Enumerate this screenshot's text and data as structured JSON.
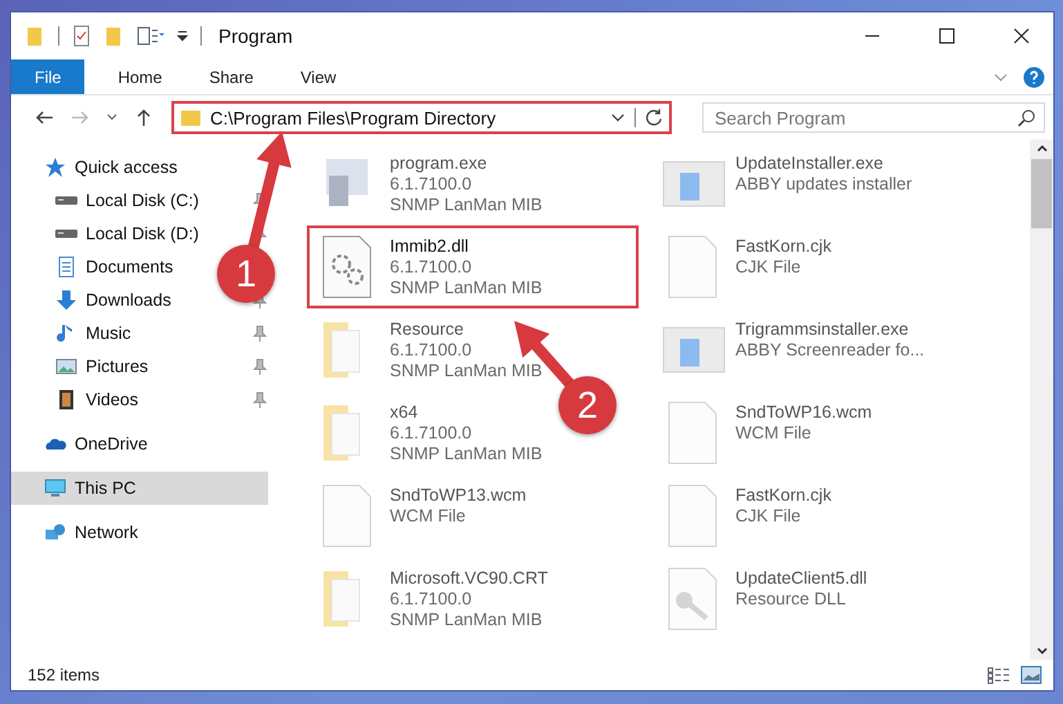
{
  "window": {
    "title": "Program"
  },
  "ribbon_tabs": [
    {
      "label": "File",
      "kind": "file"
    },
    {
      "label": "Home",
      "kind": "tab"
    },
    {
      "label": "Share",
      "kind": "tab"
    },
    {
      "label": "View",
      "kind": "tab"
    }
  ],
  "address": {
    "path": "C:\\Program Files\\Program Directory",
    "highlighted": true
  },
  "search": {
    "placeholder": "Search Program"
  },
  "sidebar": [
    {
      "label": "Quick access",
      "kind": "star",
      "selected": false,
      "children": [
        {
          "label": "Local Disk (C:)",
          "kind": "drive",
          "pinned": true,
          "selected": false
        },
        {
          "label": "Local Disk (D:)",
          "kind": "drive",
          "pinned": true,
          "selected": false
        },
        {
          "label": "Documents",
          "kind": "document",
          "selected": false
        },
        {
          "label": "Downloads",
          "kind": "download",
          "pinned": true,
          "selected": false
        },
        {
          "label": "Music",
          "kind": "music",
          "pinned": true,
          "selected": false
        },
        {
          "label": "Pictures",
          "kind": "pictures",
          "pinned": true,
          "selected": false
        },
        {
          "label": "Videos",
          "kind": "videos",
          "pinned": true,
          "selected": false
        }
      ]
    },
    {
      "label": "OneDrive",
      "kind": "cloud",
      "selected": false
    },
    {
      "label": "This PC",
      "kind": "pc",
      "selected": true
    },
    {
      "label": "Network",
      "kind": "network",
      "selected": false
    }
  ],
  "files": [
    {
      "name": "program.exe",
      "details": [
        "6.1.7100.0",
        "SNMP LanMan MIB"
      ],
      "kind": "program",
      "highlighted": false
    },
    {
      "name": "Immib2.dll",
      "details": [
        "6.1.7100.0",
        "SNMP LanMan MIB"
      ],
      "kind": "dll",
      "highlighted": true
    },
    {
      "name": "Resource",
      "details": [
        "6.1.7100.0",
        "SNMP LanMan MIB"
      ],
      "kind": "folder",
      "highlighted": false
    },
    {
      "name": "x64",
      "details": [
        "6.1.7100.0",
        "SNMP LanMan MIB"
      ],
      "kind": "folder",
      "highlighted": false
    },
    {
      "name": "SndToWP13.wcm",
      "details": [
        "WCM File"
      ],
      "kind": "file",
      "highlighted": false
    },
    {
      "name": "Microsoft.VC90.CRT",
      "details": [
        "6.1.7100.0",
        "SNMP LanMan MIB"
      ],
      "kind": "folder",
      "highlighted": false
    },
    {
      "name": "UpdateInstaller.exe",
      "details": [
        "ABBY updates installer"
      ],
      "kind": "installer",
      "highlighted": false
    },
    {
      "name": "FastKorn.cjk",
      "details": [
        "CJK File"
      ],
      "kind": "file",
      "highlighted": false
    },
    {
      "name": "Trigrammsinstaller.exe",
      "details": [
        "ABBY Screenreader fo..."
      ],
      "kind": "installer",
      "highlighted": false
    },
    {
      "name": "SndToWP16.wcm",
      "details": [
        "WCM File"
      ],
      "kind": "file",
      "highlighted": false
    },
    {
      "name": "FastKorn.cjk",
      "details": [
        "CJK File"
      ],
      "kind": "file",
      "highlighted": false
    },
    {
      "name": "UpdateClient5.dll",
      "details": [
        "Resource DLL"
      ],
      "kind": "library",
      "highlighted": false
    }
  ],
  "status_bar": {
    "item_count": "152 items"
  },
  "annotations": [
    {
      "label": "1"
    },
    {
      "label": "2"
    }
  ]
}
